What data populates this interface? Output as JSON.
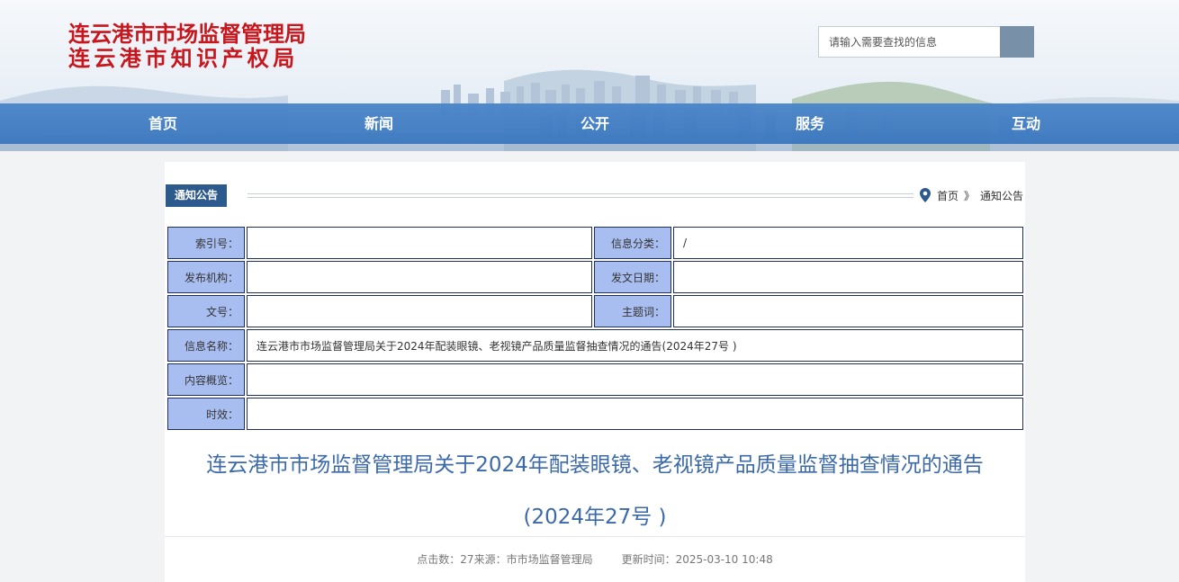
{
  "header": {
    "title_line1": "连云港市市场监督管理局",
    "title_line2": "连云港市知识产权局",
    "search": {
      "placeholder": "请输入需要查找的信息"
    }
  },
  "nav": {
    "items": [
      "首页",
      "新闻",
      "公开",
      "服务",
      "互动"
    ]
  },
  "section": {
    "tag": "通知公告"
  },
  "breadcrumb": {
    "home": "首页",
    "separator": "》",
    "current": "通知公告"
  },
  "meta": {
    "index_no_label": "索引号：",
    "index_no": "",
    "category_label": "信息分类：",
    "category": "/",
    "publisher_label": "发布机构：",
    "publisher": "",
    "date_label": "发文日期：",
    "date": "",
    "doc_no_label": "文号：",
    "doc_no": "",
    "subject_label": "主题词：",
    "subject": "",
    "name_label": "信息名称：",
    "name": "连云港市市场监督管理局关于2024年配装眼镜、老视镜产品质量监督抽查情况的通告(2024年27号 )",
    "summary_label": "内容概览：",
    "summary": "",
    "validity_label": "时效：",
    "validity": ""
  },
  "article": {
    "title_line1": "连云港市市场监督管理局关于2024年配装眼镜、老视镜产品质量监督抽查情况的通告",
    "title_line2": "(2024年27号 )",
    "clicks": "点击数：27",
    "source": "来源：市市场监督管理局",
    "updated": "更新时间：2025-03-10 10:48"
  },
  "colors": {
    "brand_red": "#c8161d",
    "nav_blue": "#4a86c9",
    "tag_blue": "#2d5a8c",
    "label_bg": "#a8bdf0",
    "title_blue": "#3c69a8"
  },
  "icons": {
    "search": "search-icon",
    "breadcrumb": "location-pin-icon"
  }
}
